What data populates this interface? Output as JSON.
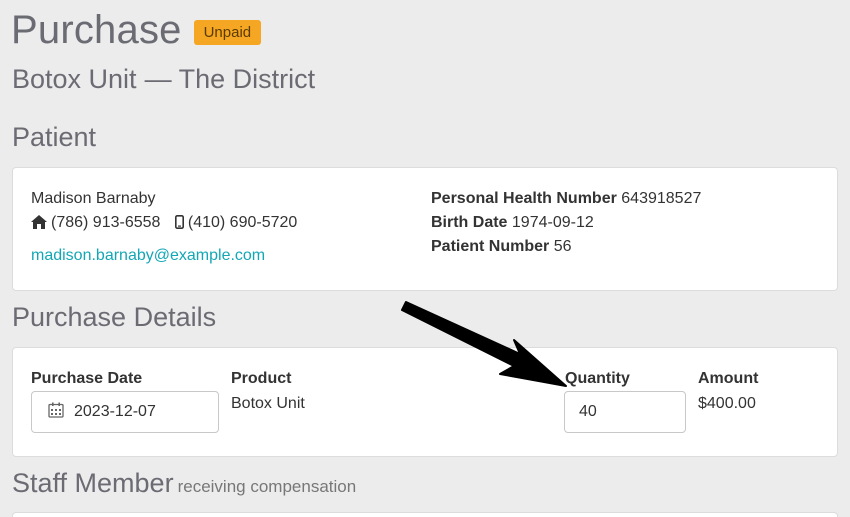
{
  "header": {
    "title": "Purchase",
    "status_badge": "Unpaid",
    "product": "Botox Unit",
    "location": "— The District"
  },
  "patient": {
    "section_title": "Patient",
    "name": "Madison Barnaby",
    "home_phone": "(786) 913-6558",
    "mobile_phone": "(410) 690-5720",
    "email": "madison.barnaby@example.com",
    "phn_label": "Personal Health Number",
    "phn_value": "643918527",
    "birth_label": "Birth Date",
    "birth_value": "1974-09-12",
    "number_label": "Patient Number",
    "number_value": "56"
  },
  "purchase_details": {
    "section_title": "Purchase Details",
    "date_label": "Purchase Date",
    "date_value": "2023-12-07",
    "product_label": "Product",
    "product_value": "Botox Unit",
    "quantity_label": "Quantity",
    "quantity_value": "40",
    "amount_label": "Amount",
    "amount_value": "$400.00"
  },
  "staff": {
    "section_title": "Staff Member",
    "section_subtitle": "receiving compensation"
  },
  "colors": {
    "badge": "#f5a623",
    "link": "#13a7b5",
    "background": "#ececec"
  },
  "icons": [
    "home-icon",
    "mobile-phone-icon",
    "calendar-icon",
    "annotation-arrow-icon"
  ]
}
